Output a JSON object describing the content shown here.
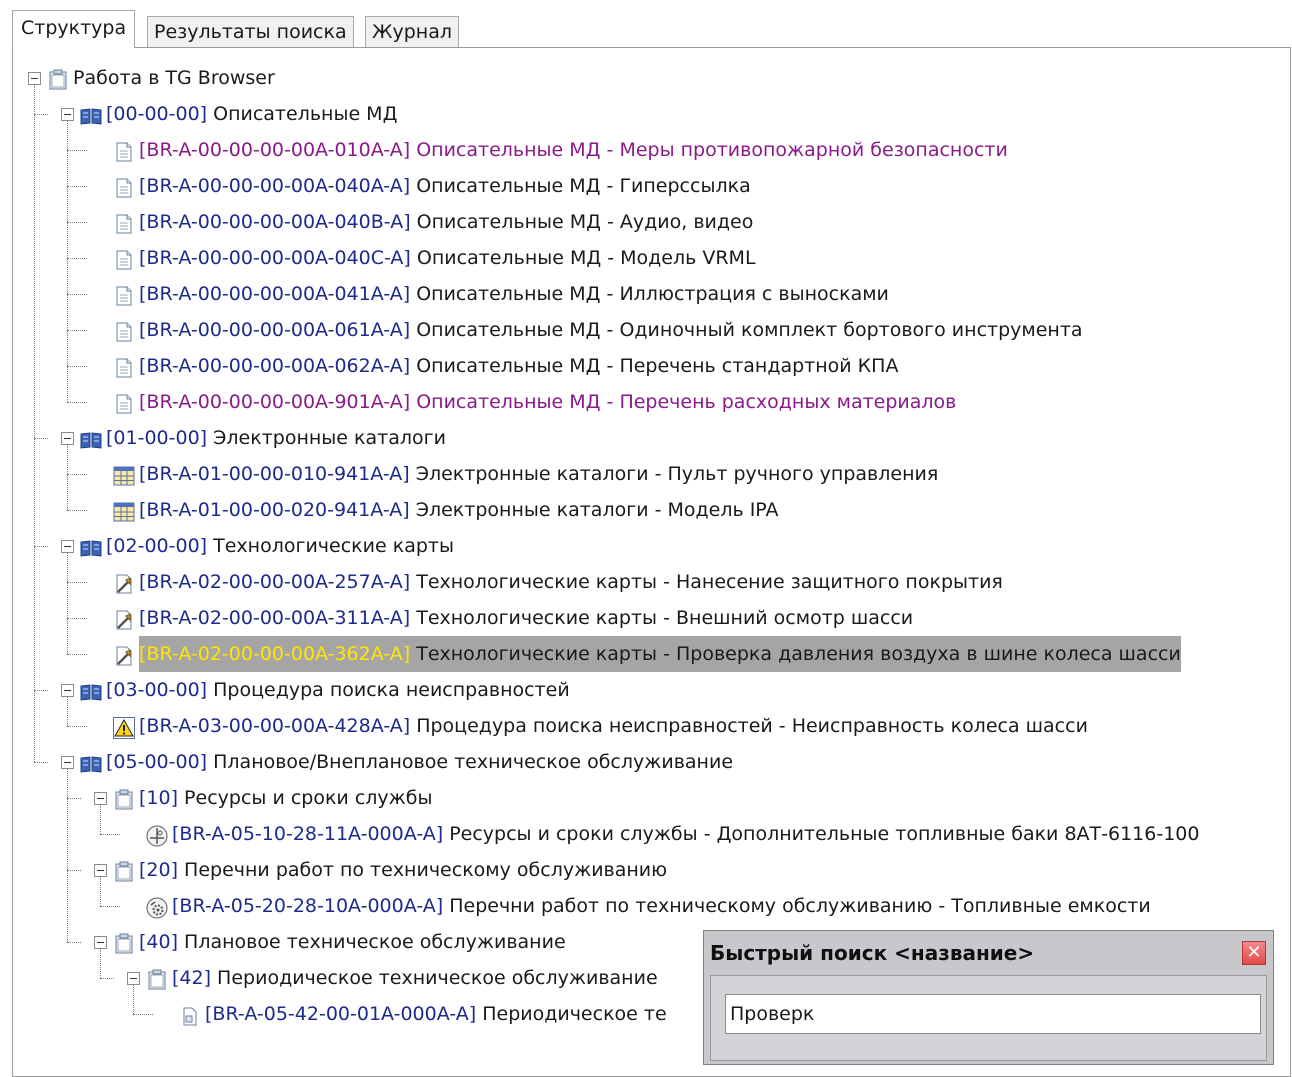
{
  "tabs": [
    "Структура",
    "Результаты поиска",
    "Журнал"
  ],
  "tree": [
    {
      "code": "",
      "text": "Работа в TG Browser"
    },
    {
      "code": "[00-00-00]",
      "text": " Описательные МД"
    },
    {
      "code": "[BR-A-00-00-00-00A-010A-A]",
      "text": " Описательные МД - Меры противопожарной безопасности"
    },
    {
      "code": "[BR-A-00-00-00-00A-040A-A]",
      "text": " Описательные МД - Гиперссылка"
    },
    {
      "code": "[BR-A-00-00-00-00A-040B-A]",
      "text": " Описательные МД - Аудио, видео"
    },
    {
      "code": "[BR-A-00-00-00-00A-040C-A]",
      "text": " Описательные МД - Модель VRML"
    },
    {
      "code": "[BR-A-00-00-00-00A-041A-A]",
      "text": " Описательные МД - Иллюстрация с выносками"
    },
    {
      "code": "[BR-A-00-00-00-00A-061A-A]",
      "text": " Описательные МД - Одиночный комплект бортового инструмента"
    },
    {
      "code": "[BR-A-00-00-00-00A-062A-A]",
      "text": " Описательные МД - Перечень стандартной КПА"
    },
    {
      "code": "[BR-A-00-00-00-00A-901A-A]",
      "text": " Описательные МД - Перечень расходных материалов"
    },
    {
      "code": "[01-00-00]",
      "text": " Электронные каталоги"
    },
    {
      "code": "[BR-A-01-00-00-010-941A-A]",
      "text": " Электронные каталоги - Пульт ручного управления"
    },
    {
      "code": "[BR-A-01-00-00-020-941A-A]",
      "text": " Электронные каталоги - Модель IPA"
    },
    {
      "code": "[02-00-00]",
      "text": " Технологические карты"
    },
    {
      "code": "[BR-A-02-00-00-00A-257A-A]",
      "text": " Технологические карты - Нанесение защитного покрытия"
    },
    {
      "code": "[BR-A-02-00-00-00A-311A-A]",
      "text": " Технологические карты - Внешний осмотр шасси"
    },
    {
      "code": "[BR-A-02-00-00-00A-362A-A]",
      "text": " Технологические карты - Проверка давления воздуха в шине колеса шасси"
    },
    {
      "code": "[03-00-00]",
      "text": " Процедура поиска неисправностей"
    },
    {
      "code": "[BR-A-03-00-00-00A-428A-A]",
      "text": " Процедура поиска неисправностей - Неисправность колеса шасси"
    },
    {
      "code": "[05-00-00]",
      "text": " Плановое/Внеплановое техническое обслуживание"
    },
    {
      "code": "[10]",
      "text": " Ресурсы и сроки службы"
    },
    {
      "code": "[BR-A-05-10-28-11A-000A-A]",
      "text": " Ресурсы и сроки службы - Дополнительные топливные баки 8АТ-6116-100"
    },
    {
      "code": "[20]",
      "text": " Перечни работ по техническому обслуживанию"
    },
    {
      "code": "[BR-A-05-20-28-10A-000A-A]",
      "text": " Перечни работ по техническому обслуживанию - Топливные емкости"
    },
    {
      "code": "[40]",
      "text": " Плановое техническое обслуживание"
    },
    {
      "code": "[42]",
      "text": " Периодическое техническое обслуживание"
    },
    {
      "code": "[BR-A-05-42-00-01A-000A-A]",
      "text": " Периодическое те"
    }
  ],
  "quick_search": {
    "title": "Быстрый поиск <название>",
    "value": "Проверк"
  },
  "colors": {
    "code_blue": "#1c2a8c",
    "purple": "#8a1a8a",
    "selection": "#a5a5a5",
    "selected_code": "#ffe600"
  }
}
